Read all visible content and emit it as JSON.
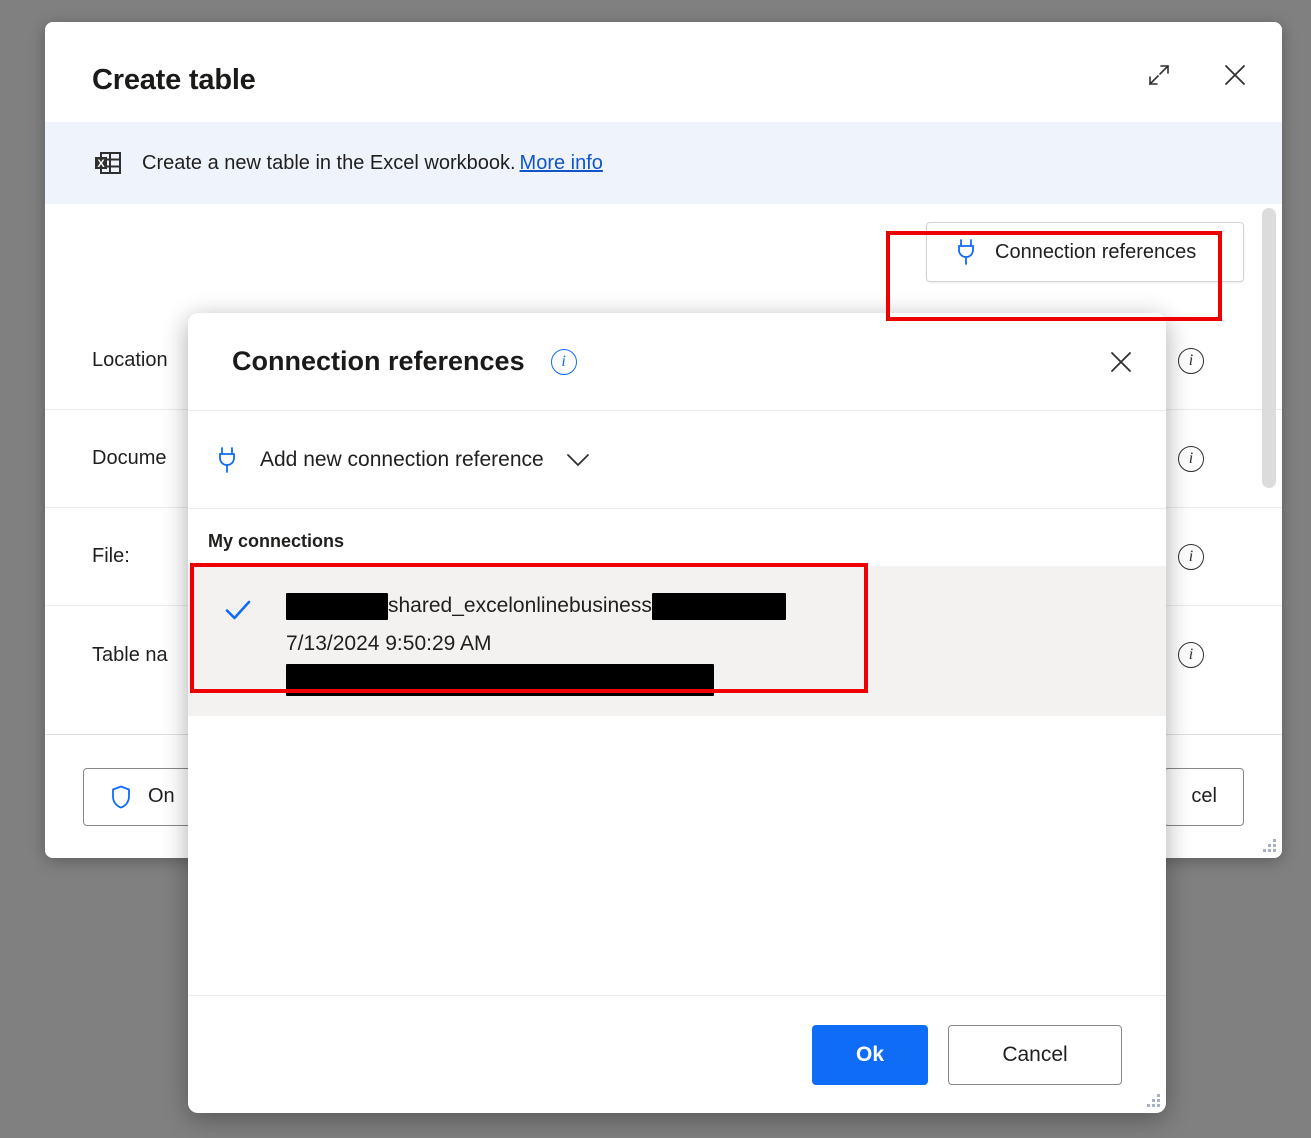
{
  "main_window": {
    "title": "Create table",
    "header_actions": [
      {
        "name": "expand",
        "icon": "expand-icon",
        "tooltip": "Expand"
      },
      {
        "name": "close",
        "icon": "close-icon",
        "tooltip": "Close"
      }
    ],
    "banner": {
      "icon": "excel-table-icon",
      "text": "Create a new table in the Excel workbook.",
      "link_label": "More info"
    },
    "connection_references_button": {
      "label": "Connection references",
      "icon": "plug-icon"
    },
    "form_rows": [
      {
        "label": "Location",
        "info_icon": "info-icon"
      },
      {
        "label": "Docume",
        "info_icon": "info-icon"
      },
      {
        "label": "File:",
        "info_icon": "info-icon"
      },
      {
        "label": "Table na",
        "info_icon": "info-icon"
      }
    ],
    "footer": {
      "left_button_label": "On",
      "left_button_icon": "shield-icon",
      "right_button_label": "cel"
    }
  },
  "dialog": {
    "title": "Connection references",
    "title_info_icon": "info-icon",
    "close_icon": "close-icon",
    "add_new": {
      "label": "Add new connection reference",
      "icon": "plug-icon",
      "chevron": "chevron-down-icon"
    },
    "group_title": "My connections",
    "connections": [
      {
        "selected": true,
        "check_icon": "check-icon",
        "name_prefix_redacted": true,
        "name_visible": "shared_excelonlinebusiness",
        "name_suffix_redacted": true,
        "timestamp": "7/13/2024 9:50:29 AM",
        "detail_redacted": true
      }
    ],
    "footer": {
      "ok_label": "Ok",
      "cancel_label": "Cancel"
    }
  },
  "annotations": [
    {
      "target": "connection-references-button",
      "color": "#ee0000"
    },
    {
      "target": "connection-list-item",
      "color": "#ee0000"
    }
  ],
  "colors": {
    "accent_blue": "#0f6cf7",
    "link_blue": "#1155cc",
    "banner_bg": "#eff3fc",
    "selected_row_bg": "#f3f2f1",
    "annotation_red": "#ee0000",
    "page_bg": "#808080"
  }
}
